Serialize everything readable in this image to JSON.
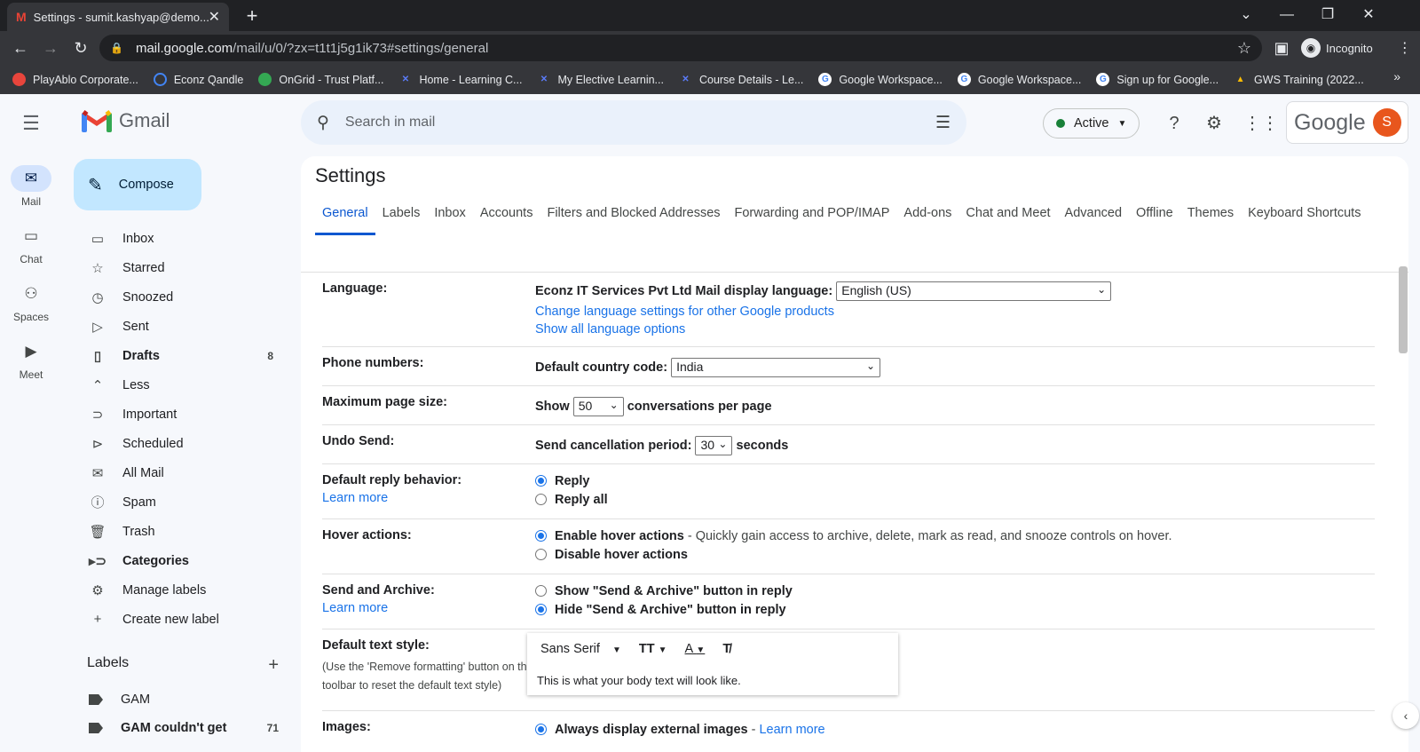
{
  "browser": {
    "tab_title": "Settings - sumit.kashyap@demo...",
    "url_host": "mail.google.com",
    "url_path": "/mail/u/0/?zx=t1t1j5g1ik73#settings/general",
    "incognito_label": "Incognito",
    "bookmarks": [
      {
        "label": "PlayAblo Corporate...",
        "color": "#e8453c"
      },
      {
        "label": "Econz Qandle",
        "color": "#4285f4"
      },
      {
        "label": "OnGrid - Trust Platf...",
        "color": "#34a853"
      },
      {
        "label": "Home - Learning C...",
        "color": "#5b7cfa"
      },
      {
        "label": "My Elective Learnin...",
        "color": "#5b7cfa"
      },
      {
        "label": "Course Details - Le...",
        "color": "#5b7cfa"
      },
      {
        "label": "Google Workspace...",
        "color": "#ffffff"
      },
      {
        "label": "Google Workspace...",
        "color": "#ffffff"
      },
      {
        "label": "Sign up for Google...",
        "color": "#ffffff"
      },
      {
        "label": "GWS Training (2022...",
        "color": "#fbbc04"
      }
    ]
  },
  "gmail": {
    "brand": "Gmail",
    "compose_label": "Compose",
    "rail": [
      {
        "label": "Mail",
        "icon": "mail-icon"
      },
      {
        "label": "Chat",
        "icon": "chat-icon"
      },
      {
        "label": "Spaces",
        "icon": "spaces-icon"
      },
      {
        "label": "Meet",
        "icon": "meet-icon"
      }
    ],
    "nav": [
      {
        "label": "Inbox",
        "icon": "inbox-icon",
        "count": ""
      },
      {
        "label": "Starred",
        "icon": "star-icon",
        "count": ""
      },
      {
        "label": "Snoozed",
        "icon": "clock-icon",
        "count": ""
      },
      {
        "label": "Sent",
        "icon": "send-icon",
        "count": ""
      },
      {
        "label": "Drafts",
        "icon": "draft-icon",
        "count": "8"
      },
      {
        "label": "Less",
        "icon": "chevron-up-icon",
        "count": ""
      },
      {
        "label": "Important",
        "icon": "important-icon",
        "count": ""
      },
      {
        "label": "Scheduled",
        "icon": "scheduled-icon",
        "count": ""
      },
      {
        "label": "All Mail",
        "icon": "all-mail-icon",
        "count": ""
      },
      {
        "label": "Spam",
        "icon": "spam-icon",
        "count": ""
      },
      {
        "label": "Trash",
        "icon": "trash-icon",
        "count": ""
      },
      {
        "label": "Categories",
        "icon": "label-icon",
        "count": ""
      },
      {
        "label": "Manage labels",
        "icon": "gear-icon",
        "count": ""
      },
      {
        "label": "Create new label",
        "icon": "plus-icon",
        "count": ""
      }
    ],
    "labels_title": "Labels",
    "labels": [
      {
        "label": "GAM",
        "count": ""
      },
      {
        "label": "GAM couldn't get",
        "count": "71"
      }
    ],
    "search_placeholder": "Search in mail",
    "status_label": "Active",
    "google_word": "Google",
    "avatar_letter": "S"
  },
  "settings": {
    "title": "Settings",
    "tabs": [
      "General",
      "Labels",
      "Inbox",
      "Accounts",
      "Filters and Blocked Addresses",
      "Forwarding and POP/IMAP",
      "Add-ons",
      "Chat and Meet",
      "Advanced",
      "Offline",
      "Themes",
      "Keyboard Shortcuts"
    ],
    "language": {
      "label": "Language:",
      "display_label": "Econz IT Services Pvt Ltd Mail display language:",
      "value": "English (US)",
      "link1": "Change language settings for other Google products",
      "link2": "Show all language options"
    },
    "phone": {
      "label": "Phone numbers:",
      "text": "Default country code:",
      "value": "India"
    },
    "page_size": {
      "label": "Maximum page size:",
      "pre": "Show",
      "value": "50",
      "post": "conversations per page"
    },
    "undo": {
      "label": "Undo Send:",
      "pre": "Send cancellation period:",
      "value": "30",
      "post": "seconds"
    },
    "reply": {
      "label": "Default reply behavior:",
      "learn": "Learn more",
      "opt1": "Reply",
      "opt2": "Reply all"
    },
    "hover": {
      "label": "Hover actions:",
      "opt1": "Enable hover actions",
      "opt1_desc": "- Quickly gain access to archive, delete, mark as read, and snooze controls on hover.",
      "opt2": "Disable hover actions"
    },
    "send_archive": {
      "label": "Send and Archive:",
      "learn": "Learn more",
      "opt1": "Show \"Send & Archive\" button in reply",
      "opt2": "Hide \"Send & Archive\" button in reply"
    },
    "text_style": {
      "label": "Default text style:",
      "hint": "(Use the 'Remove formatting' button on the toolbar to reset the default text style)",
      "font": "Sans Serif",
      "sample": "This is what your body text will look like."
    },
    "images": {
      "label": "Images:",
      "opt1": "Always display external images",
      "learn": "Learn more"
    }
  }
}
